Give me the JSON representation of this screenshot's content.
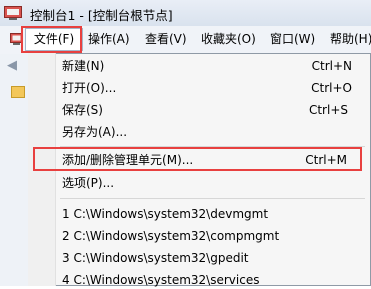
{
  "window": {
    "title": "控制台1 - [控制台根节点]"
  },
  "menubar": {
    "items": [
      {
        "label": "文件(F)"
      },
      {
        "label": "操作(A)"
      },
      {
        "label": "查看(V)"
      },
      {
        "label": "收藏夹(O)"
      },
      {
        "label": "窗口(W)"
      },
      {
        "label": "帮助(H)"
      }
    ]
  },
  "file_menu": {
    "items": [
      {
        "label": "新建(N)",
        "shortcut": "Ctrl+N"
      },
      {
        "label": "打开(O)...",
        "shortcut": "Ctrl+O"
      },
      {
        "label": "保存(S)",
        "shortcut": "Ctrl+S"
      },
      {
        "label": "另存为(A)..."
      },
      {
        "label": "添加/删除管理单元(M)...",
        "shortcut": "Ctrl+M"
      },
      {
        "label": "选项(P)..."
      },
      {
        "label": "1 C:\\Windows\\system32\\devmgmt"
      },
      {
        "label": "2 C:\\Windows\\system32\\compmgmt"
      },
      {
        "label": "3 C:\\Windows\\system32\\gpedit"
      },
      {
        "label": "4 C:\\Windows\\system32\\services"
      }
    ]
  },
  "icons": {
    "app": "mmc-console-icon",
    "back": "back-arrow-icon",
    "tree_folder": "folder-icon"
  },
  "colors": {
    "highlight_border": "#e8403f",
    "menu_background": "#f6f6f6",
    "titlebar": "#dce5f0"
  }
}
